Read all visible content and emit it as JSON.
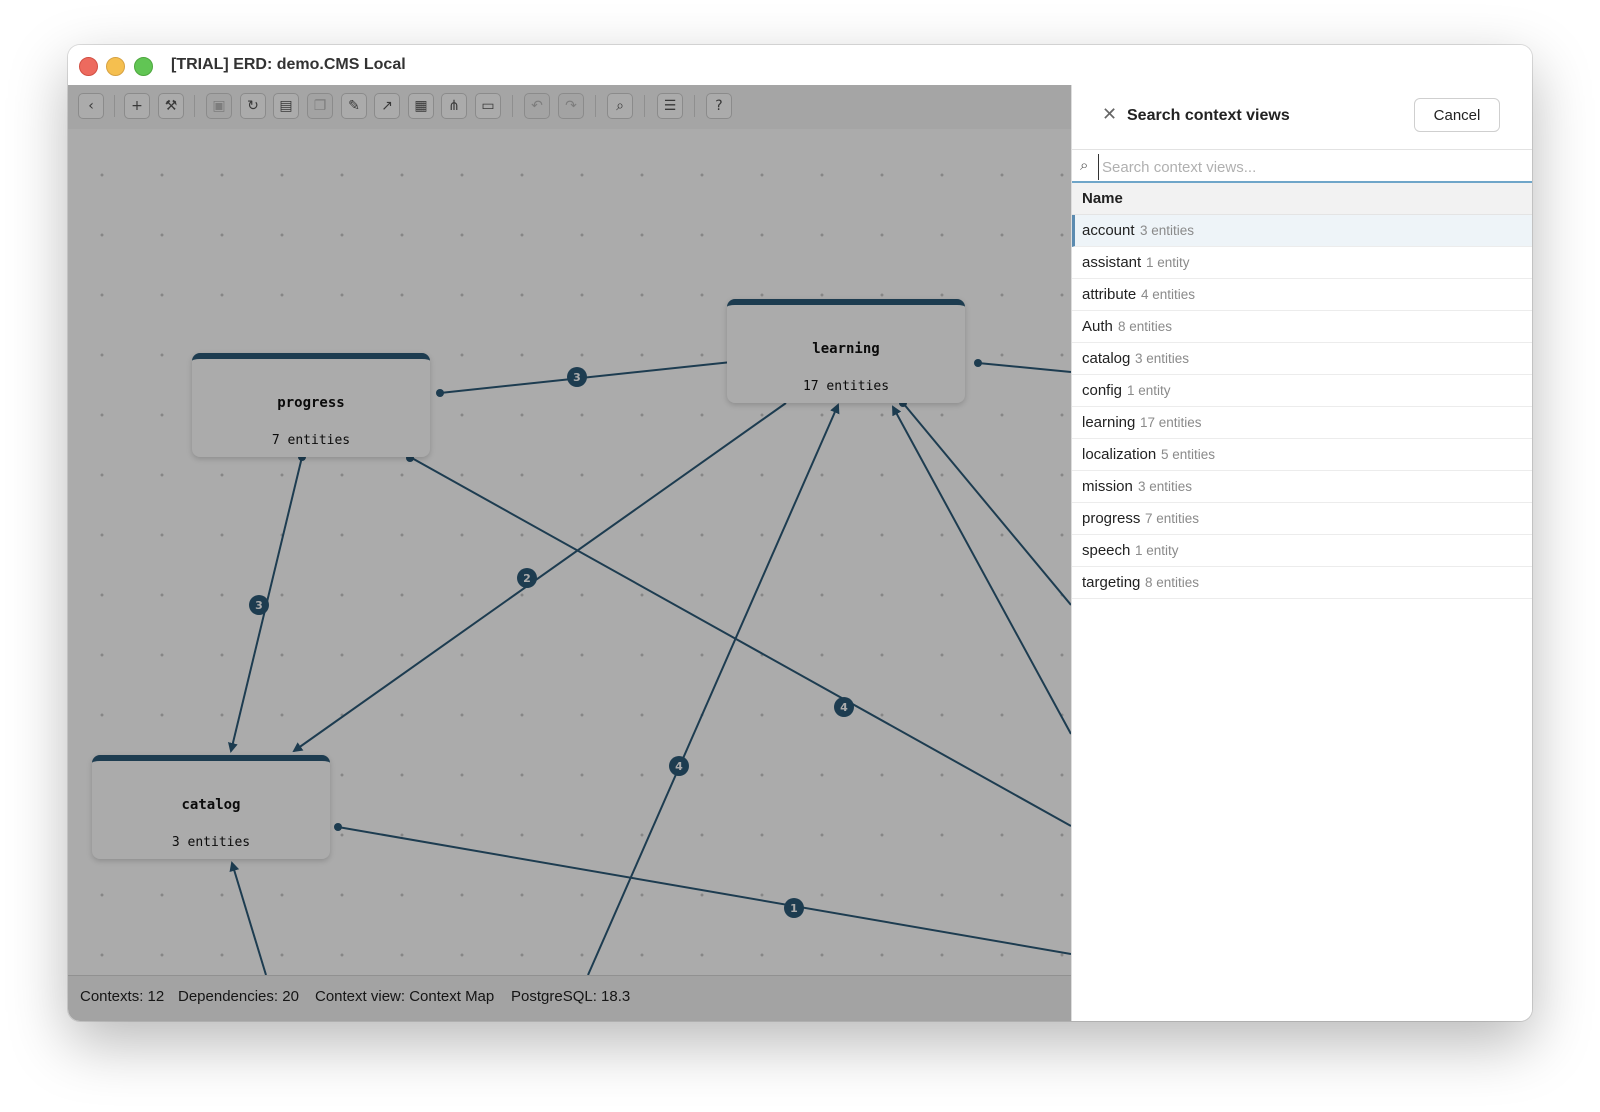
{
  "window": {
    "title": "[TRIAL] ERD: demo.CMS Local"
  },
  "toolbar": {
    "buttons": [
      {
        "icon": "back-icon",
        "glyph": "‹"
      },
      {
        "icon": "add-icon",
        "glyph": "+"
      },
      {
        "icon": "wrench-icon",
        "glyph": "⚒"
      },
      {
        "icon": "save-icon",
        "glyph": "▣"
      },
      {
        "icon": "refresh-icon",
        "glyph": "↻"
      },
      {
        "icon": "layout-icon",
        "glyph": "▤"
      },
      {
        "icon": "copy-icon",
        "glyph": "❐"
      },
      {
        "icon": "edit-icon",
        "glyph": "✎"
      },
      {
        "icon": "export-icon",
        "glyph": "↗"
      },
      {
        "icon": "grid-icon",
        "glyph": "▦"
      },
      {
        "icon": "hierarchy-icon",
        "glyph": "⋔"
      },
      {
        "icon": "folder-icon",
        "glyph": "▭"
      },
      {
        "icon": "undo-icon",
        "glyph": "↶"
      },
      {
        "icon": "redo-icon",
        "glyph": "↷"
      },
      {
        "icon": "search-icon",
        "glyph": "⌕"
      },
      {
        "icon": "notes-icon",
        "glyph": "☰"
      },
      {
        "icon": "help-icon",
        "glyph": "?"
      }
    ]
  },
  "diagram": {
    "nodes": {
      "progress": {
        "title": "progress",
        "count": "7 entities"
      },
      "learning": {
        "title": "learning",
        "count": "17 entities"
      },
      "catalog": {
        "title": "catalog",
        "count": "3 entities"
      }
    },
    "edge_labels": [
      "3",
      "3",
      "2",
      "4",
      "4",
      "1"
    ]
  },
  "status": {
    "contexts": "Contexts: 12",
    "dependencies": "Dependencies: 20",
    "context_view": "Context view: Context Map",
    "postgres": "PostgreSQL: 18.3"
  },
  "panel": {
    "title": "Search context views",
    "cancel_label": "Cancel",
    "search_placeholder": "Search context views...",
    "column_header": "Name",
    "items": [
      {
        "name": "account",
        "count": "3 entities"
      },
      {
        "name": "assistant",
        "count": "1 entity"
      },
      {
        "name": "attribute",
        "count": "4 entities"
      },
      {
        "name": "Auth",
        "count": "8 entities"
      },
      {
        "name": "catalog",
        "count": "3 entities"
      },
      {
        "name": "config",
        "count": "1 entity"
      },
      {
        "name": "learning",
        "count": "17 entities"
      },
      {
        "name": "localization",
        "count": "5 entities"
      },
      {
        "name": "mission",
        "count": "3 entities"
      },
      {
        "name": "progress",
        "count": "7 entities"
      },
      {
        "name": "speech",
        "count": "1 entity"
      },
      {
        "name": "targeting",
        "count": "8 entities"
      }
    ]
  },
  "colors": {
    "edge": "#2c5a78",
    "accent": "#5b8bb0"
  }
}
